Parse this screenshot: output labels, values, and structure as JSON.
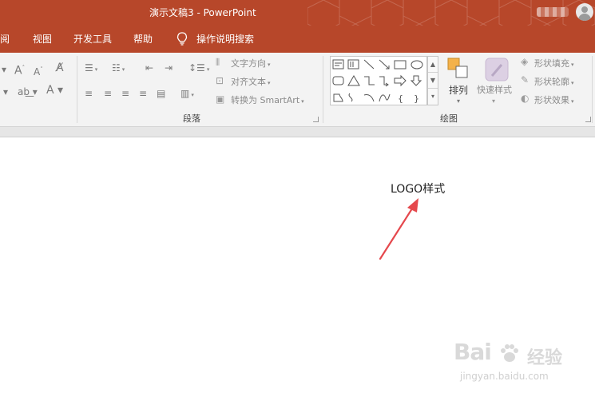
{
  "titlebar": {
    "title": "演示文稿3  -  PowerPoint"
  },
  "tabs": [
    {
      "label": "审阅"
    },
    {
      "label": "视图"
    },
    {
      "label": "开发工具"
    },
    {
      "label": "帮助"
    },
    {
      "label": "操作说明搜索"
    }
  ],
  "ribbon": {
    "paragraph": {
      "text_direction": "文字方向",
      "align_text": "对齐文本",
      "convert_smartart": "转换为 SmartArt",
      "group_label": "段落"
    },
    "drawing": {
      "arrange": "排列",
      "quick_styles": "快速样式",
      "shape_fill": "形状填充",
      "shape_outline": "形状轮廓",
      "shape_effects": "形状效果",
      "group_label": "绘图"
    }
  },
  "slide": {
    "text": "LOGO样式"
  },
  "watermark": {
    "logo": "Bai",
    "cn": "经验",
    "url": "jingyan.baidu.com"
  },
  "colors": {
    "accent": "#b7472a",
    "annotation_arrow": "#e5484d"
  }
}
